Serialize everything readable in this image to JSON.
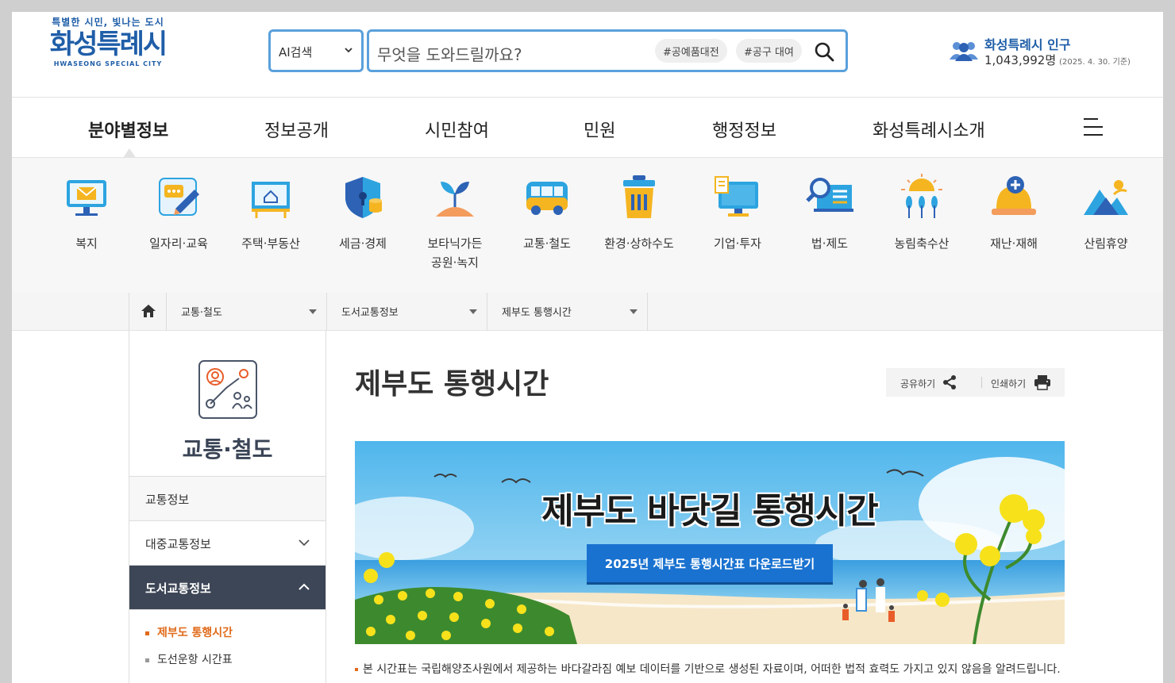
{
  "header": {
    "logo_tagline": "특별한 시민, 빛나는 도시",
    "logo_name": "화성특례시",
    "logo_english": "HWASEONG SPECIAL CITY",
    "search_select": "AI검색",
    "search_placeholder": "무엇을 도와드릴까요?",
    "chips": [
      "#공예품대전",
      "#공구 대여"
    ],
    "population_title": "화성특례시 인구",
    "population_value": "1,043,992명",
    "population_date": "(2025. 4. 30. 기준)"
  },
  "gnb": {
    "items": [
      "분야별정보",
      "정보공개",
      "시민참여",
      "민원",
      "행정정보",
      "화성특례시소개"
    ]
  },
  "categories": [
    {
      "label": "복지",
      "icon": "monitor-mail-icon"
    },
    {
      "label": "일자리·교육",
      "icon": "chat-pencil-icon"
    },
    {
      "label": "주택·부동산",
      "icon": "house-board-icon"
    },
    {
      "label": "세금·경제",
      "icon": "shield-coin-icon"
    },
    {
      "label": "보타닉가든\n공원·녹지",
      "icon": "sprout-icon"
    },
    {
      "label": "교통·철도",
      "icon": "bus-icon"
    },
    {
      "label": "환경·상하수도",
      "icon": "trash-bin-icon"
    },
    {
      "label": "기업·투자",
      "icon": "monitor-doc-icon"
    },
    {
      "label": "법·제도",
      "icon": "magnifier-doc-icon"
    },
    {
      "label": "농림축수산",
      "icon": "sun-wheat-icon"
    },
    {
      "label": "재난·재해",
      "icon": "helmet-cross-icon"
    },
    {
      "label": "산림휴양",
      "icon": "mountain-icon"
    }
  ],
  "breadcrumb": [
    "교통·철도",
    "도서교통정보",
    "제부도 통행시간"
  ],
  "sidebar": {
    "title": "교통·철도",
    "items": [
      "교통정보",
      "대중교통정보",
      "도서교통정보"
    ],
    "subitems": [
      "제부도 통행시간",
      "도선운항 시간표"
    ]
  },
  "content": {
    "title": "제부도 통행시간",
    "share_label": "공유하기",
    "print_label": "인쇄하기",
    "banner_title": "제부도 바닷길 통행시간",
    "banner_button": "2025년 제부도 통행시간표 다운로드받기",
    "note": "본 시간표는 국립해양조사원에서 제공하는 바다갈라짐 예보 데이터를 기반으로 생성된 자료이며, 어떠한 법적 효력도 가지고 있지 않음을 알려드립니다."
  }
}
